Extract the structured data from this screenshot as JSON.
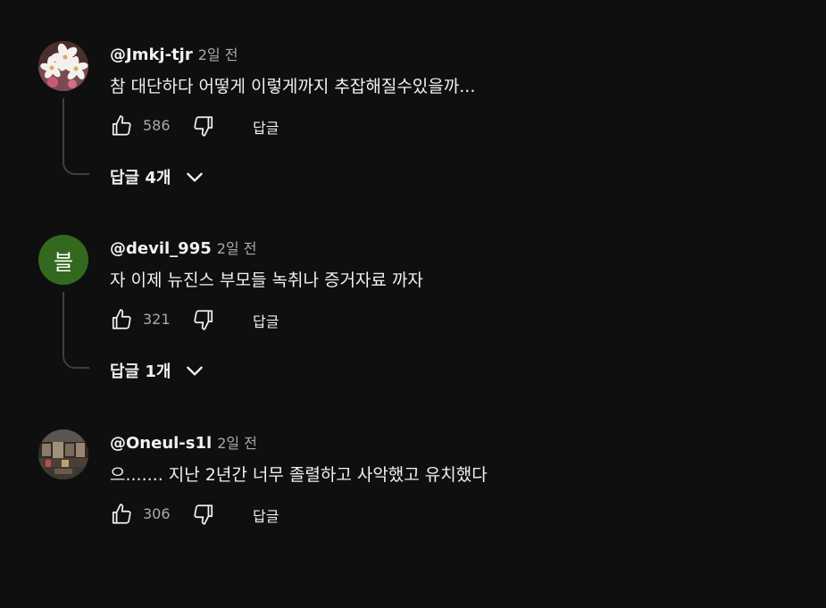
{
  "comments": [
    {
      "author": "@Jmkj-tjr",
      "time": "2일 전",
      "text": "참 대단하다 어떻게 이렇게까지 추잡해질수있을까...",
      "likes": "586",
      "reply_label": "답글",
      "replies_label": "답글 4개",
      "avatar_icon": "flower-photo",
      "avatar_letter": ""
    },
    {
      "author": "@devil_995",
      "time": "2일 전",
      "text": "자 이제 뉴진스 부모들 녹취나 증거자료 까자",
      "likes": "321",
      "reply_label": "답글",
      "replies_label": "답글 1개",
      "avatar_icon": "letter-avatar",
      "avatar_letter": "블",
      "avatar_color": "#33691e"
    },
    {
      "author": "@Oneul-s1l",
      "time": "2일 전",
      "text": "으....... 지난 2년간 너무 졸렬하고 사악했고 유치했다",
      "likes": "306",
      "reply_label": "답글",
      "avatar_icon": "room-photo",
      "avatar_letter": ""
    }
  ],
  "colors": {
    "background": "#0f0f0f",
    "text_primary": "#f1f1f1",
    "text_secondary": "#aaaaaa",
    "thread_line": "#3f3f3f"
  },
  "icons": {
    "like": "thumb-up-icon",
    "dislike": "thumb-down-icon",
    "expand": "chevron-down-icon"
  }
}
